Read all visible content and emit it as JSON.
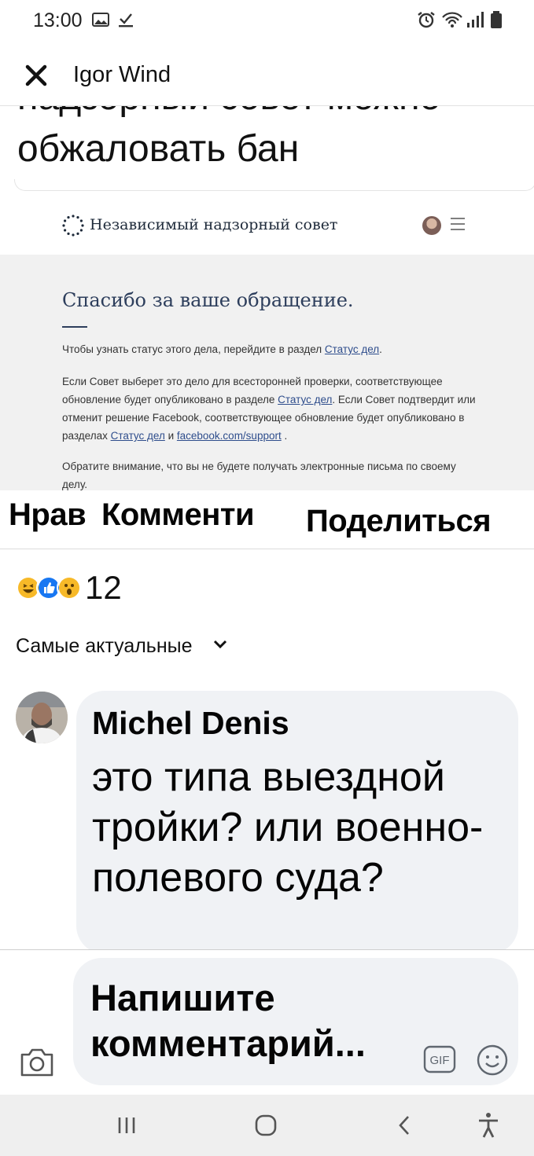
{
  "status_bar": {
    "time": "13:00",
    "left_icons": [
      "gallery-icon",
      "download-check-icon"
    ],
    "right_icons": [
      "alarm-icon",
      "wifi-icon",
      "signal-icon",
      "battery-icon"
    ]
  },
  "header": {
    "close_icon": "close-icon",
    "author": "Igor Wind"
  },
  "post": {
    "text_line_1": "надзорный совет можно",
    "text_line_2": "обжаловать бан"
  },
  "embed": {
    "site_title": "Независимый надзорный совет",
    "heading": "Спасибо за ваше обращение.",
    "p1_text": "Чтобы узнать статус этого дела, перейдите в раздел ",
    "p1_link": "Статус дел",
    "p1_end": ".",
    "p2_a": "Если Совет выберет это дело для всесторонней проверки, соответствующее обновление будет опубликовано в разделе ",
    "p2_link1": "Статус дел",
    "p2_b": ". Если Совет подтвердит или отменит решение Facebook, соответствующее обновление будет опубликовано в разделах ",
    "p2_link2": "Статус дел",
    "p2_c": " и ",
    "p2_link3": "facebook.com/support",
    "p2_end": " .",
    "p3_text": "Обратите внимание, что вы не будете получать электронные письма по своему делу."
  },
  "actions": {
    "like": "Нрав",
    "comment": "Комменти",
    "share": "Поделиться"
  },
  "reactions": {
    "icons": [
      "haha-icon",
      "like-icon",
      "wow-icon"
    ],
    "count": "12"
  },
  "sort": {
    "label": "Самые актуальные"
  },
  "comment": {
    "author": "Michel Denis",
    "text": "это типа выездной тройки? или военно-полевого суда?"
  },
  "composer": {
    "placeholder": "Напишите комментарий..."
  },
  "colors": {
    "fb_blue": "#1877f2",
    "bubble_bg": "#f0f2f5",
    "embed_heading": "#2d3e5c"
  }
}
